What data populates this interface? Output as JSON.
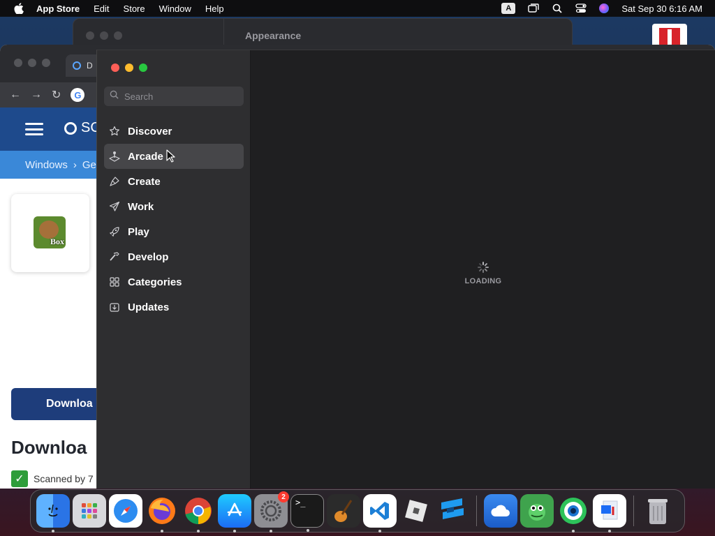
{
  "menubar": {
    "app_name": "App Store",
    "menus": [
      "Edit",
      "Store",
      "Window",
      "Help"
    ],
    "input_indicator": "A",
    "datetime": "Sat Sep 30  6:16 AM"
  },
  "background_window": {
    "title": "Appearance"
  },
  "browser": {
    "tab_title": "D",
    "site_search_text": "SC",
    "breadcrumb": [
      "Windows",
      "›",
      "Ge"
    ],
    "app_logo_text": "Box",
    "download_button": "Downloa",
    "download_heading": "Downloa",
    "scanned_text": "Scanned by 7"
  },
  "appstore": {
    "search_placeholder": "Search",
    "nav": [
      {
        "label": "Discover",
        "icon": "star-icon"
      },
      {
        "label": "Arcade",
        "icon": "joystick-icon",
        "selected": true
      },
      {
        "label": "Create",
        "icon": "brush-icon"
      },
      {
        "label": "Work",
        "icon": "paper-plane-icon"
      },
      {
        "label": "Play",
        "icon": "rocket-icon"
      },
      {
        "label": "Develop",
        "icon": "hammer-icon"
      },
      {
        "label": "Categories",
        "icon": "grid-icon"
      },
      {
        "label": "Updates",
        "icon": "download-tray-icon"
      }
    ],
    "loading_text": "LOADING"
  },
  "dock": {
    "apps": [
      {
        "name": "Finder",
        "color": "#3d8bf2"
      },
      {
        "name": "Launchpad",
        "color": "#d8d8dc"
      },
      {
        "name": "Safari",
        "color": "#2d8cf0"
      },
      {
        "name": "Firefox",
        "color": "#ff7a18"
      },
      {
        "name": "Chrome",
        "color": "#ffffff"
      },
      {
        "name": "App Store",
        "color": "#1c8cf5"
      },
      {
        "name": "System Settings",
        "color": "#8e8e93",
        "badge": "2"
      },
      {
        "name": "Terminal",
        "color": "#1a1a1a"
      },
      {
        "name": "GarageBand",
        "color": "#2b2b2b"
      },
      {
        "name": "Visual Studio Code",
        "color": "#ffffff"
      },
      {
        "name": "Roblox",
        "color": "#e8e8e8"
      },
      {
        "name": "Roblox Studio",
        "color": "#1e9bf0"
      },
      {
        "name": "Weather",
        "color": "#2f7de1"
      },
      {
        "name": "Game",
        "color": "#3fa34d"
      },
      {
        "name": "Browser",
        "color": "#e8f6ff"
      },
      {
        "name": "Remote Desktop",
        "color": "#ffffff"
      },
      {
        "name": "Trash",
        "color": "#9a9aa0"
      }
    ]
  }
}
